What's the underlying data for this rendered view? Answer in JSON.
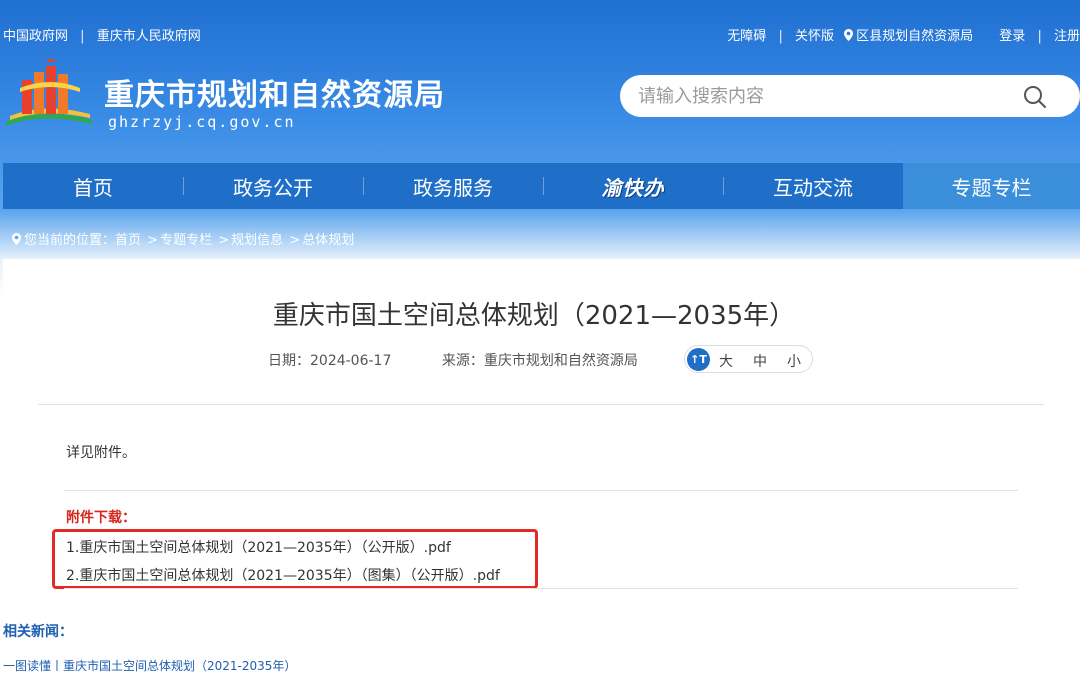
{
  "topbar": {
    "left_links": [
      "中国政府网",
      "重庆市人民政府网"
    ],
    "separator": "|",
    "right_links": [
      "无障碍",
      "关怀版",
      "区县规划自然资源局",
      "登录",
      "注册"
    ]
  },
  "site": {
    "title": "重庆市规划和自然资源局",
    "domain": "ghzrzyj.cq.gov.cn"
  },
  "search": {
    "placeholder": "请输入搜索内容",
    "icon": "search-icon"
  },
  "nav": {
    "items": [
      "首页",
      "政务公开",
      "政务服务",
      "渝快办",
      "互动交流",
      "专题专栏"
    ],
    "active_index": 5
  },
  "breadcrumb": {
    "prefix": "您当前的位置：",
    "items": [
      "首页",
      "专题专栏",
      "规划信息",
      "总体规划"
    ],
    "sep": ">"
  },
  "article": {
    "title": "重庆市国土空间总体规划（2021—2035年）",
    "date_label": "日期：2024-06-17",
    "source_label": "来源：重庆市规划和自然资源局",
    "font_size_icon_text": "T",
    "font_sizes": [
      "大",
      "中",
      "小"
    ],
    "body": "详见附件。",
    "attachments_label": "附件下载：",
    "attachments": [
      "1.重庆市国土空间总体规划（2021—2035年）（公开版）.pdf",
      "2.重庆市国土空间总体规划（2021—2035年）（图集）（公开版）.pdf"
    ]
  },
  "related": {
    "label": "相关新闻：",
    "links": [
      "一图读懂丨重庆市国土空间总体规划（2021-2035年）"
    ]
  },
  "colors": {
    "nav_bg": "#1f6fc8",
    "nav_active": "#3b8ed9",
    "highlight_border": "#e32b24",
    "attachment_label": "#d7261c"
  }
}
